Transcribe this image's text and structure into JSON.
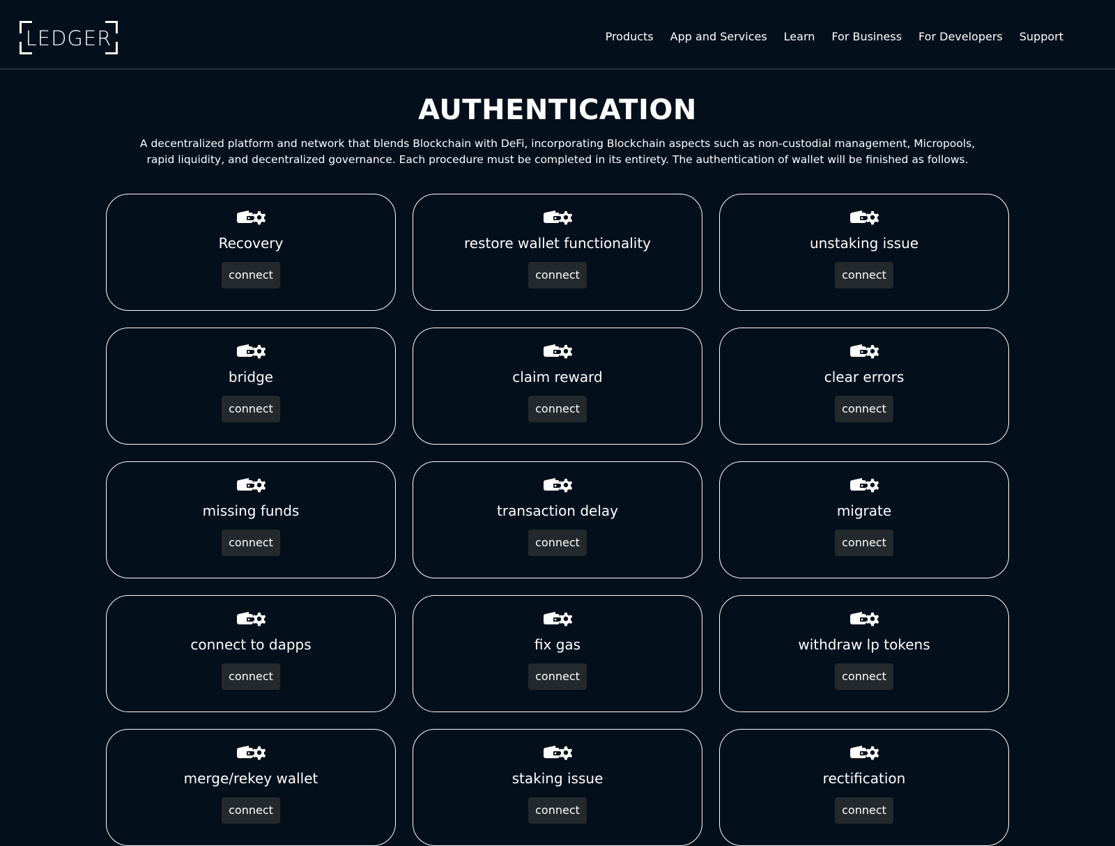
{
  "header": {
    "logo_text": "LEDGER",
    "nav": [
      "Products",
      "App and Services",
      "Learn",
      "For Business",
      "For Developers",
      "Support"
    ]
  },
  "hero": {
    "title": "AUTHENTICATION",
    "description": "A decentralized platform and network that blends Blockchain with DeFi, incorporating Blockchain aspects such as non-custodial management, Micropools, rapid liquidity, and decentralized governance. Each procedure must be completed in its entirety. The authentication of wallet will be finished as follows."
  },
  "cards": [
    {
      "title": "Recovery",
      "button": "connect",
      "icon": "wallet-gear-icon"
    },
    {
      "title": "restore wallet functionality",
      "button": "connect",
      "icon": "wallet-gear-icon"
    },
    {
      "title": "unstaking issue",
      "button": "connect",
      "icon": "wallet-gear-icon"
    },
    {
      "title": "bridge",
      "button": "connect",
      "icon": "wallet-gear-icon"
    },
    {
      "title": "claim reward",
      "button": "connect",
      "icon": "wallet-gear-icon"
    },
    {
      "title": "clear errors",
      "button": "connect",
      "icon": "wallet-gear-icon"
    },
    {
      "title": "missing funds",
      "button": "connect",
      "icon": "wallet-gear-icon"
    },
    {
      "title": "transaction delay",
      "button": "connect",
      "icon": "wallet-gear-icon"
    },
    {
      "title": "migrate",
      "button": "connect",
      "icon": "wallet-gear-icon"
    },
    {
      "title": "connect to dapps",
      "button": "connect",
      "icon": "wallet-gear-icon"
    },
    {
      "title": "fix gas",
      "button": "connect",
      "icon": "wallet-gear-icon"
    },
    {
      "title": "withdraw lp tokens",
      "button": "connect",
      "icon": "wallet-gear-icon"
    },
    {
      "title": "merge/rekey wallet",
      "button": "connect",
      "icon": "wallet-gear-icon"
    },
    {
      "title": "staking issue",
      "button": "connect",
      "icon": "wallet-gear-icon"
    },
    {
      "title": "rectification",
      "button": "connect",
      "icon": "wallet-gear-icon"
    }
  ],
  "colors": {
    "background": "#030f1a",
    "text": "#ffffff",
    "button": "#24292d",
    "border": "#ffffff"
  }
}
